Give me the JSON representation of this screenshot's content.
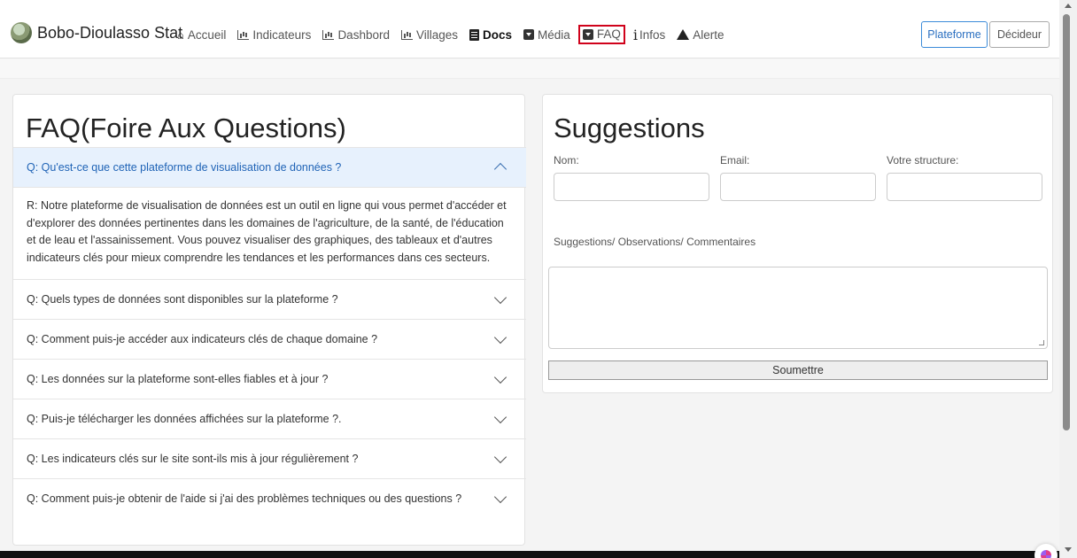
{
  "brand": {
    "name": "Bobo-Dioulasso Stat"
  },
  "nav": {
    "accueil": "Accueil",
    "indicateurs": "Indicateurs",
    "dashbord": "Dashbord",
    "villages": "Villages",
    "docs": "Docs",
    "media": "Média",
    "faq": "FAQ",
    "infos": "Infos",
    "alerte": "Alerte"
  },
  "buttons": {
    "plateforme": "Plateforme",
    "decideur": "Décideur"
  },
  "faq": {
    "title": "FAQ(Foire Aux Questions)",
    "items": [
      {
        "question": "Q: Qu'est-ce que cette plateforme de visualisation de données ?",
        "answer": "R: Notre plateforme de visualisation de données est un outil en ligne qui vous permet d'accéder et d'explorer des données pertinentes dans les domaines de l'agriculture, de la santé, de l'éducation et de leau et l'assainissement. Vous pouvez visualiser des graphiques, des tableaux et d'autres indicateurs clés pour mieux comprendre les tendances et les performances dans ces secteurs.",
        "expanded": true
      },
      {
        "question": "Q: Quels types de données sont disponibles sur la plateforme ?",
        "expanded": false
      },
      {
        "question": "Q: Comment puis-je accéder aux indicateurs clés de chaque domaine ?",
        "expanded": false
      },
      {
        "question": "Q: Les données sur la plateforme sont-elles fiables et à jour ?",
        "expanded": false
      },
      {
        "question": "Q: Puis-je télécharger les données affichées sur la plateforme ?.",
        "expanded": false
      },
      {
        "question": "Q: Les indicateurs clés sur le site sont-ils mis à jour régulièrement ?",
        "expanded": false
      },
      {
        "question": "Q: Comment puis-je obtenir de l'aide si j'ai des problèmes techniques ou des questions ?",
        "expanded": false
      }
    ]
  },
  "suggestions": {
    "title": "Suggestions",
    "nom_label": "Nom:",
    "email_label": "Email:",
    "structure_label": "Votre structure:",
    "comments_label": "Suggestions/ Observations/ Commentaires",
    "submit_label": "Soumettre"
  }
}
